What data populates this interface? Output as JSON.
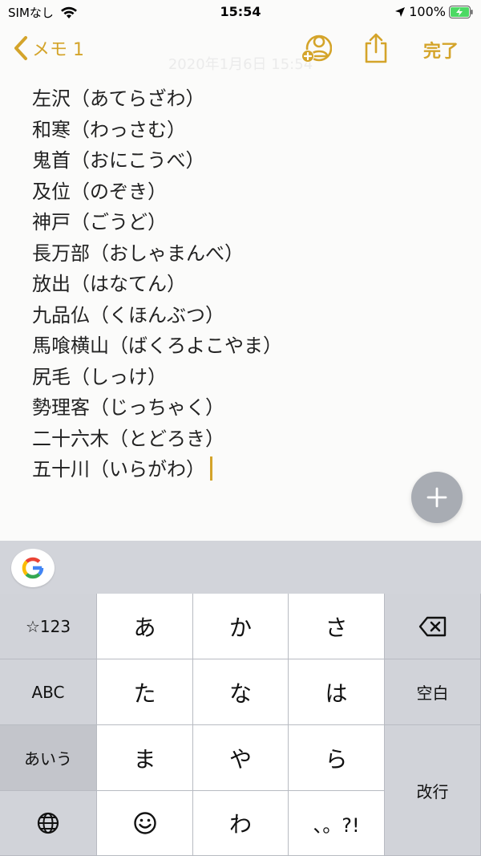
{
  "status": {
    "carrier": "SIMなし",
    "time": "15:54",
    "battery": "100%"
  },
  "nav": {
    "back_label": "メモ 1",
    "date_ghost": "2020年1月6日 15:54",
    "done_label": "完了"
  },
  "note": {
    "lines": [
      "左沢（あてらざわ）",
      "和寒（わっさむ）",
      "鬼首（おにこうべ）",
      "及位（のぞき）",
      "神戸（ごうど）",
      "長万部（おしゃまんべ）",
      "放出（はなてん）",
      "九品仏（くほんぶつ）",
      "馬喰横山（ばくろよこやま）",
      "尻毛（しっけ）",
      "勢理客（じっちゃく）",
      "二十六木（とどろき）",
      "五十川（いらがわ）"
    ]
  },
  "keyboard": {
    "numbers_key": "☆123",
    "abc_key": "ABC",
    "kana_key": "あいう",
    "space_key": "空白",
    "return_key": "改行",
    "keys": {
      "a": "あ",
      "ka": "か",
      "sa": "さ",
      "ta": "た",
      "na": "な",
      "ha": "は",
      "ma": "ま",
      "ya": "や",
      "ra": "ら",
      "wa": "わ",
      "punct": "、。?!"
    }
  },
  "colors": {
    "accent": "#d4a42a",
    "fab": "#a8acb3",
    "keyboard_gray": "#d1d3d9"
  },
  "icons": {
    "back": "chevron-left-icon",
    "collaborate": "add-person-icon",
    "share": "share-icon",
    "fab": "plus-icon",
    "delete": "backspace-icon",
    "globe": "globe-icon",
    "emoji": "smiley-icon",
    "google": "google-g-icon"
  }
}
